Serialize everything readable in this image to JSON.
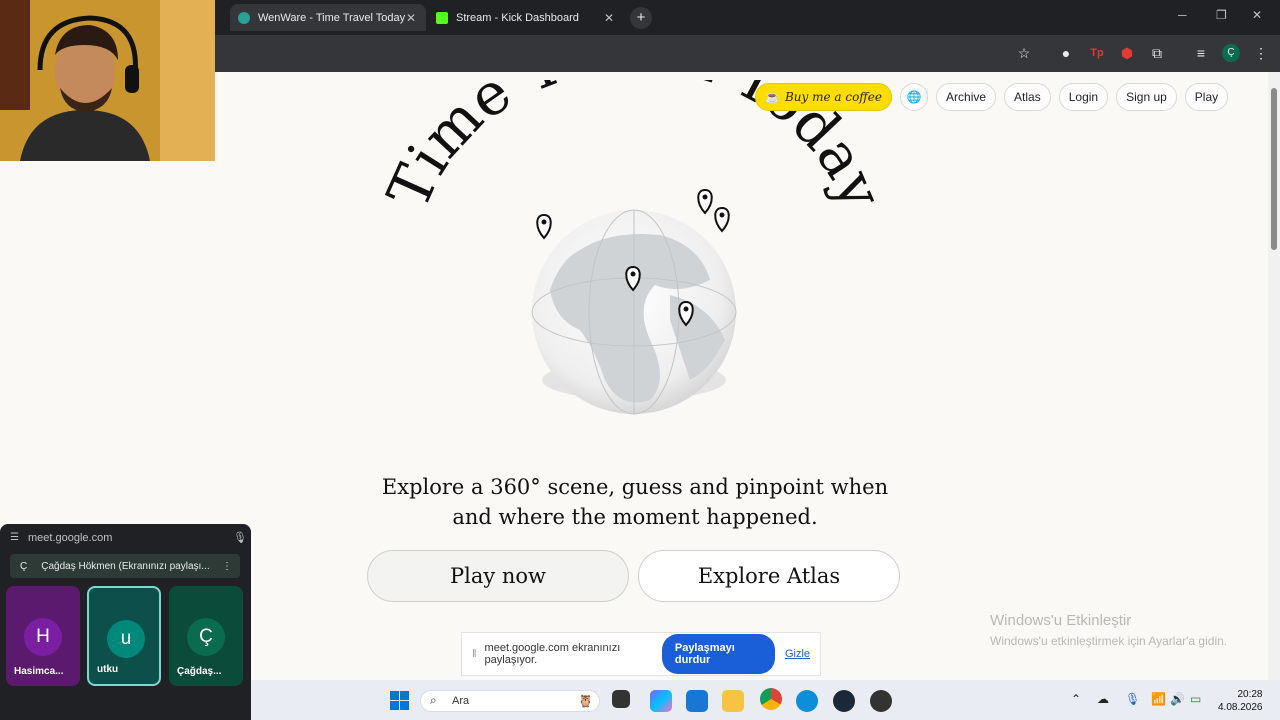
{
  "browser": {
    "tabs": [
      {
        "title": "WenWare - Time Travel Today",
        "active": true
      },
      {
        "title": "Stream - Kick Dashboard",
        "active": false
      }
    ],
    "profile_initial": "Ç",
    "extension_badge": "1"
  },
  "site": {
    "title": "Time Travel Today",
    "nav": {
      "coffee": "Buy me a coffee",
      "archive": "Archive",
      "atlas": "Atlas",
      "login": "Login",
      "signup": "Sign up",
      "play": "Play"
    },
    "tagline_line1": "Explore a 360° scene, guess and pinpoint when",
    "tagline_line2": "and where the moment happened.",
    "cta_play": "Play now",
    "cta_atlas": "Explore Atlas"
  },
  "screen_share": {
    "message": "meet.google.com ekranınızı paylaşıyor.",
    "stop": "Paylaşmayı durdur",
    "hide": "Gizle"
  },
  "windows_activation": {
    "line1": "Windows'u Etkinleştir",
    "line2": "Windows'u etkinleştirmek için Ayarlar'a gidin."
  },
  "meet": {
    "url": "meet.google.com",
    "presenter_initial": "Ç",
    "presenter_label": "Çağdaş Hökmen (Ekranınızı paylaşı...",
    "participants": [
      {
        "initial": "H",
        "name": "Hasimca...",
        "color": "#7b1fa2"
      },
      {
        "initial": "u",
        "name": "utku",
        "color": "#00897b"
      },
      {
        "initial": "Ç",
        "name": "Çağdaş...",
        "color": "#0b6b4f"
      }
    ]
  },
  "taskbar": {
    "search_label": "Ara",
    "time": "20:28",
    "date": "4.08.2026"
  }
}
